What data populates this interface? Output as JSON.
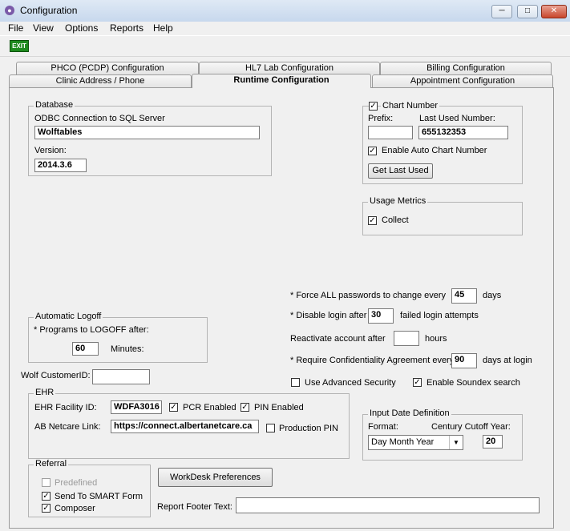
{
  "window": {
    "title": "Configuration",
    "minimize": "─",
    "maximize": "□",
    "close": "✕"
  },
  "menu": [
    "File",
    "View",
    "Options",
    "Reports",
    "Help"
  ],
  "toolbar": {
    "exit_label": "EXIT"
  },
  "tabs": {
    "back": [
      "PHCO (PCDP) Configuration",
      "HL7 Lab Configuration",
      "Billing Configuration"
    ],
    "front": [
      "Clinic Address / Phone",
      "Runtime Configuration",
      "Appointment Configuration"
    ]
  },
  "database": {
    "label": "Database",
    "odbc_label": "ODBC Connection to SQL Server",
    "odbc_value": "Wolftables",
    "version_label": "Version:",
    "version_value": "2014.3.6"
  },
  "chart_number": {
    "label": "Chart Number",
    "checked": true,
    "prefix_label": "Prefix:",
    "prefix_value": "",
    "last_used_label": "Last Used Number:",
    "last_used_value": "655132353",
    "auto_label": "Enable Auto Chart Number",
    "auto_checked": true,
    "get_last_button": "Get Last Used"
  },
  "usage_metrics": {
    "label": "Usage Metrics",
    "collect_label": "Collect",
    "collect_checked": true
  },
  "security": {
    "force_pw_label": "* Force ALL passwords to change every",
    "force_pw_value": "45",
    "force_pw_unit": "days",
    "disable_login_label": "* Disable login after",
    "disable_login_value": "30",
    "disable_login_unit": "failed login attempts",
    "reactivate_label": "Reactivate account after",
    "reactivate_value": "",
    "reactivate_unit": "hours",
    "confid_label": "* Require Confidentiality Agreement every",
    "confid_value": "90",
    "confid_unit": "days at login",
    "advanced_label": "Use Advanced Security",
    "advanced_checked": false,
    "soundex_label": "Enable Soundex search",
    "soundex_checked": true
  },
  "auto_logoff": {
    "label": "Automatic Logoff",
    "programs_label": "* Programs to LOGOFF after:",
    "minutes_value": "60",
    "minutes_label": "Minutes:"
  },
  "customer_id": {
    "label": "Wolf CustomerID:",
    "value": ""
  },
  "ehr": {
    "label": "EHR",
    "facility_label": "EHR Facility ID:",
    "facility_value": "WDFA3016",
    "pcr_label": "PCR Enabled",
    "pcr_checked": true,
    "pin_label": "PIN Enabled",
    "pin_checked": true,
    "netcare_label": "AB Netcare Link:",
    "netcare_value": "https://connect.albertanetcare.ca",
    "prod_pin_label": "Production PIN",
    "prod_pin_checked": false
  },
  "input_date": {
    "label": "Input Date Definition",
    "format_label": "Format:",
    "format_value": "Day Month Year",
    "cutoff_label": "Century Cutoff Year:",
    "cutoff_value": "20"
  },
  "referral": {
    "label": "Referral",
    "predefined_label": "Predefined",
    "send_label": "Send To SMART Form",
    "send_checked": true,
    "composer_label": "Composer",
    "composer_checked": true
  },
  "workdesk_button": "WorkDesk Preferences",
  "report_footer": {
    "label": "Report Footer Text:",
    "value": ""
  },
  "check_glyph": "✓"
}
